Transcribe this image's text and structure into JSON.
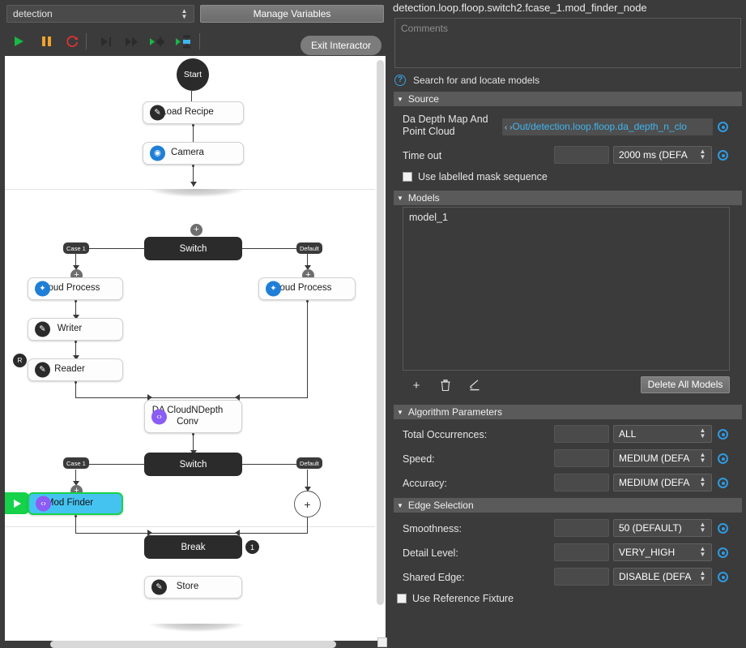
{
  "left_panel": {
    "recipe_selector": {
      "value": "detection",
      "icon": "updown-spinner-icon"
    },
    "manage_variables_button": "Manage Variables",
    "toolbar": {
      "buttons": [
        {
          "name": "run",
          "icon": "play-icon",
          "color": "#18b845"
        },
        {
          "name": "pause",
          "icon": "pause-icon",
          "color": "#f0a32e"
        },
        {
          "name": "reset",
          "icon": "reset-icon",
          "color": "#e53232"
        },
        {
          "name": "step-over",
          "icon": "step-over-icon",
          "color": "#2b2b2b"
        },
        {
          "name": "step-forward",
          "icon": "step-forward-icon",
          "color": "#2b2b2b"
        },
        {
          "name": "run-to-breakpoint",
          "icon": "run-to-node-icon",
          "color": "#2b2b2b"
        },
        {
          "name": "run-selected-node",
          "icon": "run-selected-node-icon",
          "color": "#2b2b2b"
        }
      ]
    },
    "exit_interactor_button": "Exit Interactor",
    "flow": {
      "start_label": "Start",
      "nodes": [
        {
          "label": "Load Recipe",
          "icon": "wrench-icon",
          "icon_style": "dark"
        },
        {
          "label": "Camera",
          "icon": "camera-icon",
          "icon_style": "blue"
        },
        {
          "label": "Cloud Process",
          "icon": "cloud-process-icon",
          "icon_style": "blue"
        },
        {
          "label": "Writer",
          "icon": "wrench-icon",
          "icon_style": "dark"
        },
        {
          "label": "Reader",
          "icon": "wrench-icon",
          "icon_style": "dark",
          "badge": "R"
        },
        {
          "label": "Cloud Process",
          "icon": "cloud-process-icon",
          "icon_style": "blue"
        },
        {
          "label": "DA CloudNDepth Conv",
          "icon": "code-icon",
          "icon_style": "purple"
        },
        {
          "label": "Mod Finder",
          "icon": "code-icon",
          "icon_style": "purple",
          "selected": true
        },
        {
          "label": "Store",
          "icon": "wrench-icon",
          "icon_style": "dark"
        }
      ],
      "switch_label": "Switch",
      "break_label": "Break",
      "break_badge": "1",
      "case_port_label": "Case 1",
      "default_port_label": "Default",
      "plus_label": "+"
    }
  },
  "right_panel": {
    "node_path": "detection.loop.floop.switch2.fcase_1.mod_finder_node",
    "comments_placeholder": "Comments",
    "hint_text": "Search for and locate models",
    "sections": [
      {
        "id": "source",
        "title": "Source"
      },
      {
        "id": "models",
        "title": "Models"
      },
      {
        "id": "algorithm",
        "title": "Algorithm Parameters"
      },
      {
        "id": "edge",
        "title": "Edge Selection"
      }
    ],
    "source": {
      "depth_map_label": "Da Depth Map And Point Cloud",
      "depth_map_value": "Out/detection.loop.floop.da_depth_n_clo",
      "depth_map_nav": "‹ ›",
      "timeout_label": "Time out",
      "timeout_value": "2000 ms (DEFA",
      "use_labelled_mask_label": "Use labelled mask sequence",
      "use_labelled_mask_checked": false
    },
    "models": {
      "items": [
        "model_1"
      ],
      "add_icon": "plus-icon",
      "delete_icon": "trash-icon",
      "edit_icon": "pencil-icon",
      "delete_all_button": "Delete All Models"
    },
    "algorithm": {
      "rows": [
        {
          "label": "Total Occurrences:",
          "value": "ALL"
        },
        {
          "label": "Speed:",
          "value": "MEDIUM (DEFA"
        },
        {
          "label": "Accuracy:",
          "value": "MEDIUM (DEFA"
        }
      ]
    },
    "edge": {
      "rows": [
        {
          "label": "Smoothness:",
          "value": "50 (DEFAULT)"
        },
        {
          "label": "Detail Level:",
          "value": "VERY_HIGH"
        },
        {
          "label": "Shared Edge:",
          "value": "DISABLE (DEFA"
        }
      ],
      "use_reference_fixture_label": "Use Reference Fixture",
      "use_reference_fixture_checked": false
    }
  },
  "colors": {
    "panel_bg": "#3b3b3b",
    "section_header": "#5a5a5a",
    "accent_blue": "#3fb5f0",
    "selection_green": "#16d24a",
    "selection_cyan": "#45c3f0"
  }
}
